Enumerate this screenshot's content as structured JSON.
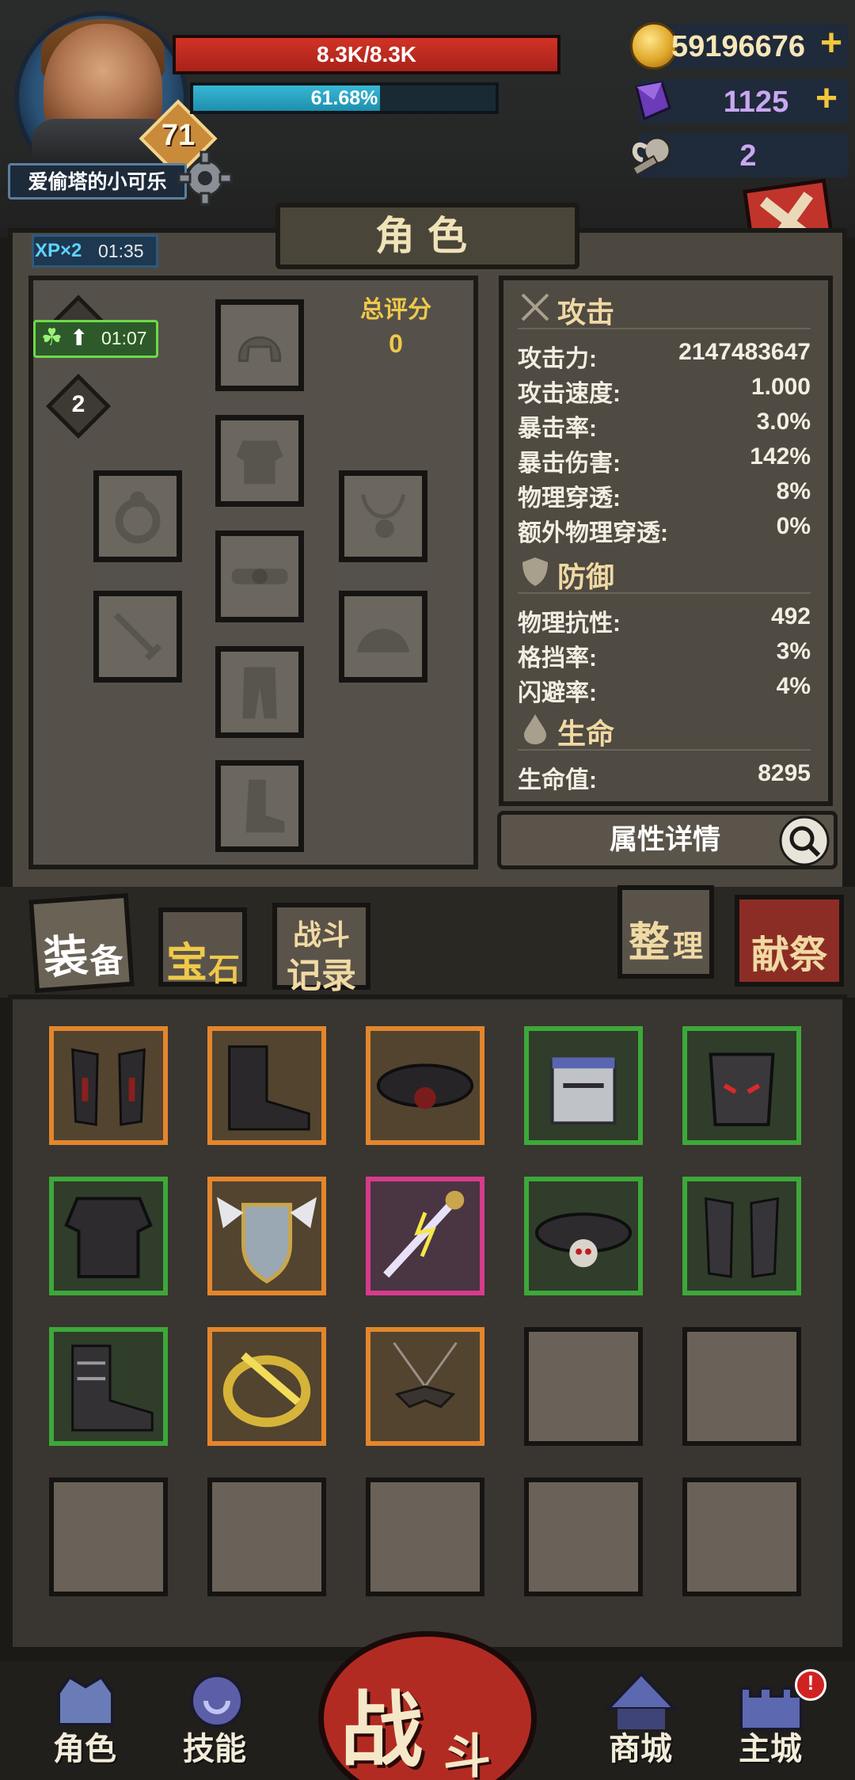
{
  "player": {
    "name": "爱偷塔的小可乐",
    "level": "71",
    "hp_text": "8.3K/8.3K",
    "xp_text": "61.68%",
    "xp_fraction": 0.6168
  },
  "currencies": {
    "gold": "59196676",
    "gems": "1125",
    "keys": "2",
    "plus": "+"
  },
  "panel": {
    "title": "角色",
    "xp_boost_label": "XP×2",
    "xp_boost_time": "01:35",
    "luck_time": "01:07",
    "enhance_level": "2",
    "score_label": "总评分",
    "score_value": "0"
  },
  "stats": {
    "attack": {
      "heading": "攻击",
      "rows": [
        {
          "label": "攻击力:",
          "value": "2147483647"
        },
        {
          "label": "攻击速度:",
          "value": "1.000"
        },
        {
          "label": "暴击率:",
          "value": "3.0%"
        },
        {
          "label": "暴击伤害:",
          "value": "142%"
        },
        {
          "label": "物理穿透:",
          "value": "8%"
        },
        {
          "label": "额外物理穿透:",
          "value": "0%"
        }
      ]
    },
    "defense": {
      "heading": "防御",
      "rows": [
        {
          "label": "物理抗性:",
          "value": "492"
        },
        {
          "label": "格挡率:",
          "value": "3%"
        },
        {
          "label": "闪避率:",
          "value": "4%"
        }
      ]
    },
    "life": {
      "heading": "生命",
      "rows": [
        {
          "label": "生命值:",
          "value": "8295"
        }
      ]
    },
    "details_button": "属性详情"
  },
  "tabs": {
    "equip_a": "装",
    "equip_b": "备",
    "gem_a": "宝",
    "gem_b": "石",
    "record_a": "战斗",
    "record_b": "记录",
    "sort_a": "整",
    "sort_b": "理",
    "sacrifice": "献祭"
  },
  "nav": {
    "character": "角色",
    "skills": "技能",
    "battle_a": "战",
    "battle_b": "斗",
    "shop": "商城",
    "city": "主城",
    "alert": "!"
  },
  "colors": {
    "rarity_orange": "#e3862d",
    "rarity_green": "#3da83a",
    "rarity_pink": "#d63b8c",
    "hp_red": "#d23326",
    "xp_cyan": "#35b8d4"
  }
}
